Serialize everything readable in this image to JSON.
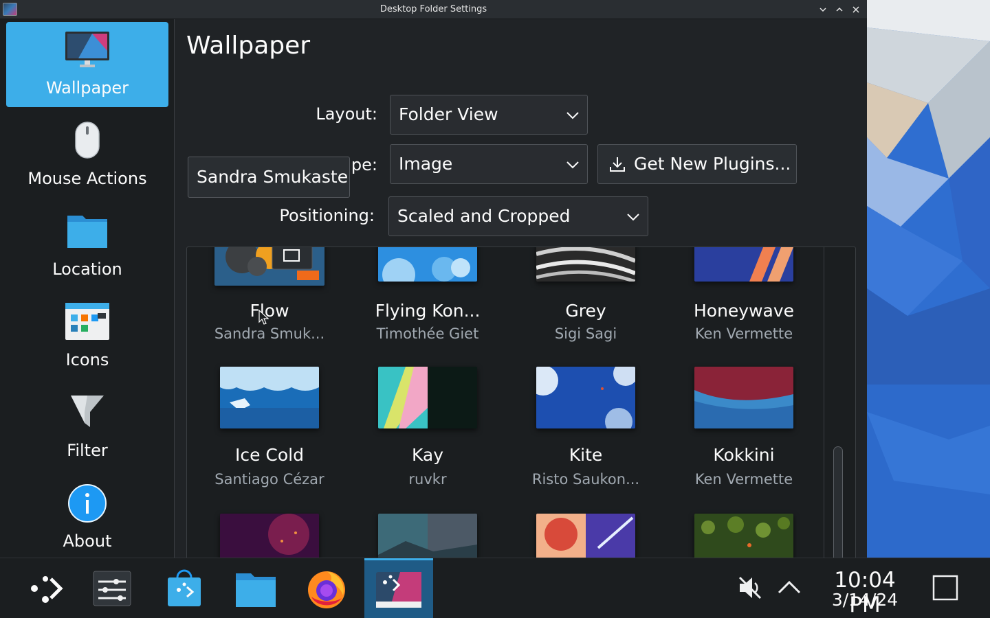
{
  "window": {
    "title": "Desktop Folder Settings",
    "controls": [
      "minimize",
      "maximize",
      "close"
    ]
  },
  "sidebar": {
    "items": [
      {
        "label": "Wallpaper",
        "icon": "monitor-icon",
        "active": true
      },
      {
        "label": "Mouse Actions",
        "icon": "mouse-icon",
        "active": false
      },
      {
        "label": "Location",
        "icon": "folder-icon",
        "active": false
      },
      {
        "label": "Icons",
        "icon": "icons-window-icon",
        "active": false
      },
      {
        "label": "Filter",
        "icon": "filter-icon",
        "active": false
      },
      {
        "label": "About",
        "icon": "info-icon",
        "active": false
      }
    ]
  },
  "main": {
    "title": "Wallpaper",
    "layout_label": "Layout:",
    "layout_value": "Folder View",
    "type_label_visible": "pe:",
    "type_value": "Image",
    "get_plugins_label": "Get New Plugins...",
    "positioning_label": "Positioning:",
    "positioning_value": "Scaled and Cropped",
    "tooltip": "Sandra Smukaste"
  },
  "wallpapers": [
    {
      "name": "Flow",
      "author": "Sandra Smuk..."
    },
    {
      "name": "Flying Kon...",
      "author": "Timothée Giet"
    },
    {
      "name": "Grey",
      "author": "Sigi Sagi"
    },
    {
      "name": "Honeywave",
      "author": "Ken Vermette"
    },
    {
      "name": "Ice Cold",
      "author": "Santiago Cézar"
    },
    {
      "name": "Kay",
      "author": "ruvkr"
    },
    {
      "name": "Kite",
      "author": "Risto Saukon..."
    },
    {
      "name": "Kokkini",
      "author": "Ken Vermette"
    }
  ],
  "taskbar": {
    "apps": [
      "app-launcher-icon",
      "system-settings-icon",
      "discover-store-icon",
      "file-manager-icon",
      "firefox-icon",
      "desktop-settings-icon"
    ],
    "clock_time": "10:04 PM",
    "clock_date": "3/14/24"
  },
  "colors": {
    "accent": "#3daee9",
    "window_bg": "#202326",
    "sidebar_bg": "#1b1e20"
  }
}
